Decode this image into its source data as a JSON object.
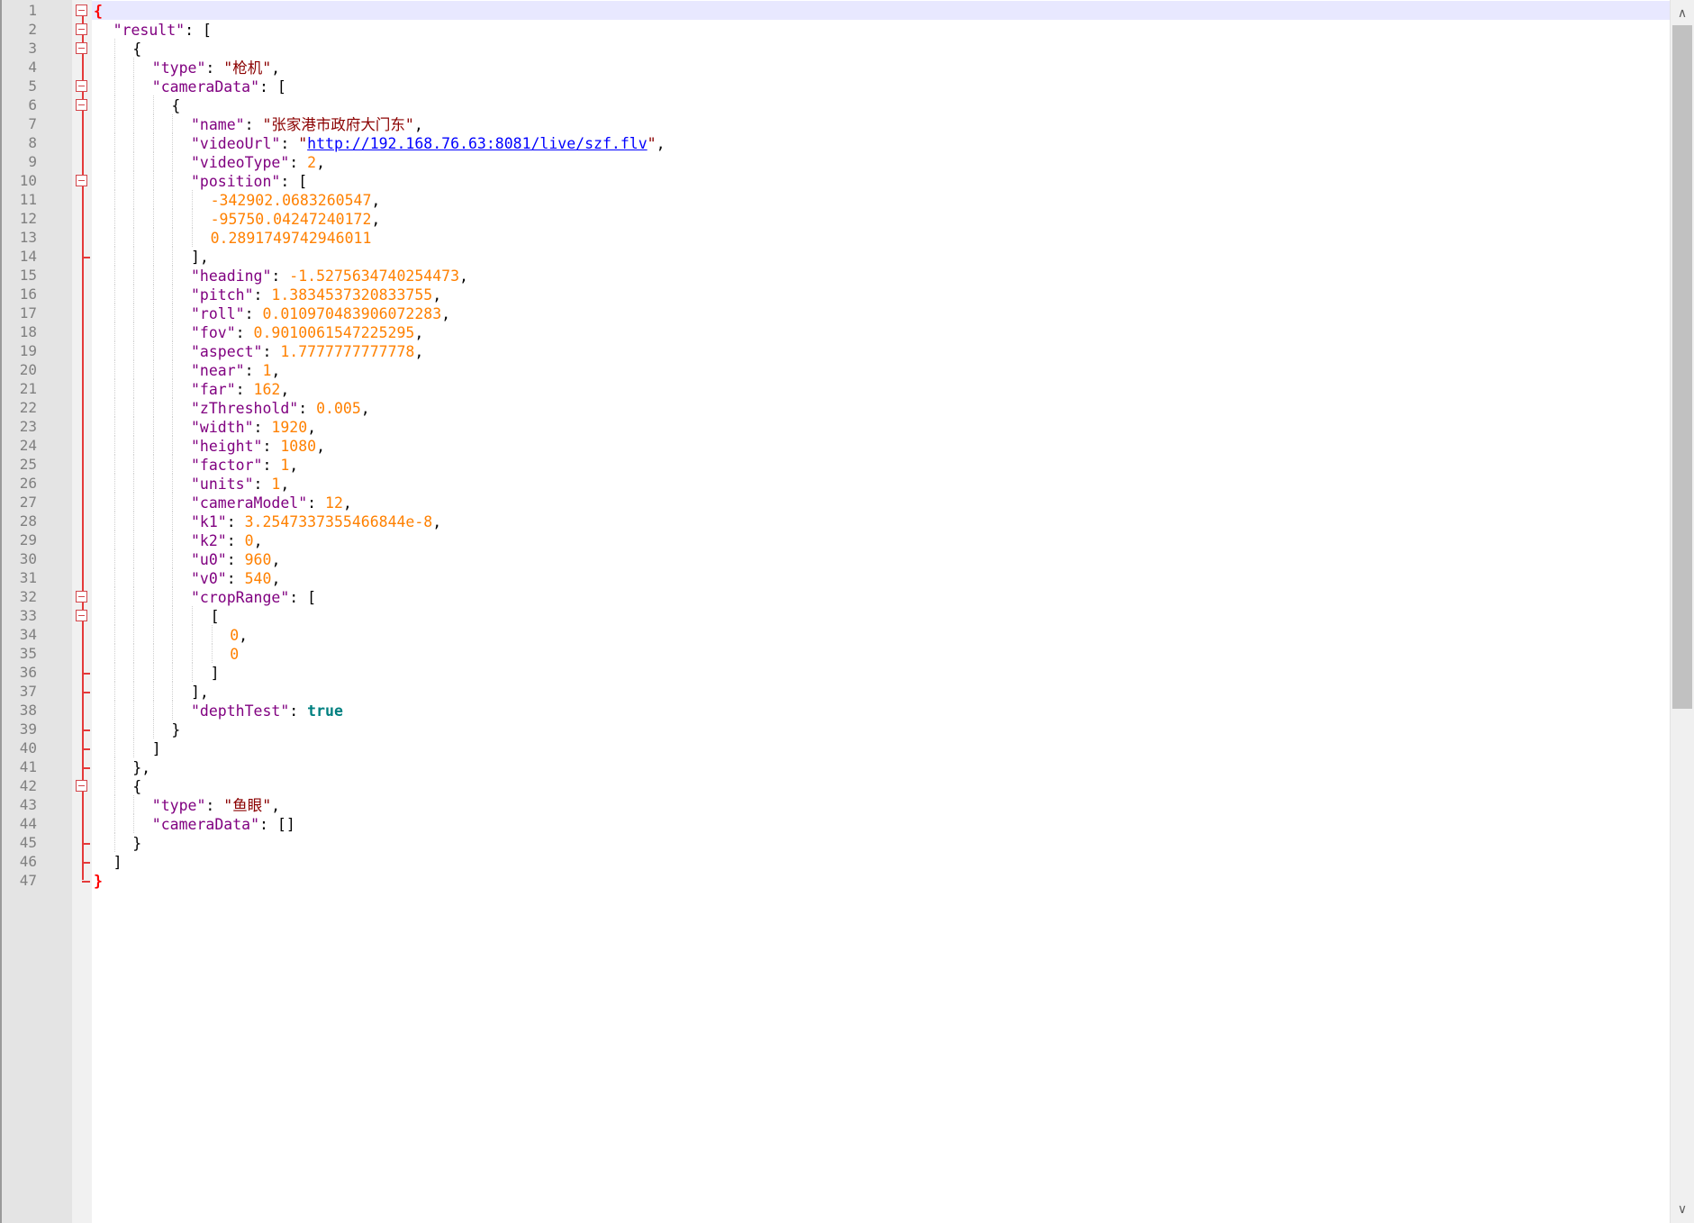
{
  "editor": {
    "line_numbers": [
      "1",
      "2",
      "3",
      "4",
      "5",
      "6",
      "7",
      "8",
      "9",
      "10",
      "11",
      "12",
      "13",
      "14",
      "15",
      "16",
      "17",
      "18",
      "19",
      "20",
      "21",
      "22",
      "23",
      "24",
      "25",
      "26",
      "27",
      "28",
      "29",
      "30",
      "31",
      "32",
      "33",
      "34",
      "35",
      "36",
      "37",
      "38",
      "39",
      "40",
      "41",
      "42",
      "43",
      "44",
      "45",
      "46",
      "47"
    ],
    "current_line": 1,
    "colors": {
      "key": "#800080",
      "string": "#8b0000",
      "number": "#ff8000",
      "bool": "#008080",
      "fold": "#e43a3a",
      "current_line_bg": "#e8e8ff"
    }
  },
  "code_lines": [
    [
      {
        "t": "br",
        "v": "{"
      }
    ],
    [
      {
        "t": "k",
        "v": "\"result\""
      },
      {
        "t": "p",
        "v": ": ["
      }
    ],
    [
      {
        "t": "p",
        "v": "{"
      }
    ],
    [
      {
        "t": "k",
        "v": "\"type\""
      },
      {
        "t": "p",
        "v": ": "
      },
      {
        "t": "s",
        "v": "\"枪机\""
      },
      {
        "t": "p",
        "v": ","
      }
    ],
    [
      {
        "t": "k",
        "v": "\"cameraData\""
      },
      {
        "t": "p",
        "v": ": ["
      }
    ],
    [
      {
        "t": "p",
        "v": "{"
      }
    ],
    [
      {
        "t": "k",
        "v": "\"name\""
      },
      {
        "t": "p",
        "v": ": "
      },
      {
        "t": "s",
        "v": "\"张家港市政府大门东\""
      },
      {
        "t": "p",
        "v": ","
      }
    ],
    [
      {
        "t": "k",
        "v": "\"videoUrl\""
      },
      {
        "t": "p",
        "v": ": "
      },
      {
        "t": "s",
        "v": "\""
      },
      {
        "t": "url",
        "v": "http://192.168.76.63:8081/live/szf.flv"
      },
      {
        "t": "s",
        "v": "\""
      },
      {
        "t": "p",
        "v": ","
      }
    ],
    [
      {
        "t": "k",
        "v": "\"videoType\""
      },
      {
        "t": "p",
        "v": ": "
      },
      {
        "t": "n",
        "v": "2"
      },
      {
        "t": "p",
        "v": ","
      }
    ],
    [
      {
        "t": "k",
        "v": "\"position\""
      },
      {
        "t": "p",
        "v": ": ["
      }
    ],
    [
      {
        "t": "n",
        "v": "-342902.0683260547"
      },
      {
        "t": "p",
        "v": ","
      }
    ],
    [
      {
        "t": "n",
        "v": "-95750.04247240172"
      },
      {
        "t": "p",
        "v": ","
      }
    ],
    [
      {
        "t": "n",
        "v": "0.2891749742946011"
      }
    ],
    [
      {
        "t": "p",
        "v": "],"
      }
    ],
    [
      {
        "t": "k",
        "v": "\"heading\""
      },
      {
        "t": "p",
        "v": ": "
      },
      {
        "t": "n",
        "v": "-1.5275634740254473"
      },
      {
        "t": "p",
        "v": ","
      }
    ],
    [
      {
        "t": "k",
        "v": "\"pitch\""
      },
      {
        "t": "p",
        "v": ": "
      },
      {
        "t": "n",
        "v": "1.3834537320833755"
      },
      {
        "t": "p",
        "v": ","
      }
    ],
    [
      {
        "t": "k",
        "v": "\"roll\""
      },
      {
        "t": "p",
        "v": ": "
      },
      {
        "t": "n",
        "v": "0.010970483906072283"
      },
      {
        "t": "p",
        "v": ","
      }
    ],
    [
      {
        "t": "k",
        "v": "\"fov\""
      },
      {
        "t": "p",
        "v": ": "
      },
      {
        "t": "n",
        "v": "0.9010061547225295"
      },
      {
        "t": "p",
        "v": ","
      }
    ],
    [
      {
        "t": "k",
        "v": "\"aspect\""
      },
      {
        "t": "p",
        "v": ": "
      },
      {
        "t": "n",
        "v": "1.7777777777778"
      },
      {
        "t": "p",
        "v": ","
      }
    ],
    [
      {
        "t": "k",
        "v": "\"near\""
      },
      {
        "t": "p",
        "v": ": "
      },
      {
        "t": "n",
        "v": "1"
      },
      {
        "t": "p",
        "v": ","
      }
    ],
    [
      {
        "t": "k",
        "v": "\"far\""
      },
      {
        "t": "p",
        "v": ": "
      },
      {
        "t": "n",
        "v": "162"
      },
      {
        "t": "p",
        "v": ","
      }
    ],
    [
      {
        "t": "k",
        "v": "\"zThreshold\""
      },
      {
        "t": "p",
        "v": ": "
      },
      {
        "t": "n",
        "v": "0.005"
      },
      {
        "t": "p",
        "v": ","
      }
    ],
    [
      {
        "t": "k",
        "v": "\"width\""
      },
      {
        "t": "p",
        "v": ": "
      },
      {
        "t": "n",
        "v": "1920"
      },
      {
        "t": "p",
        "v": ","
      }
    ],
    [
      {
        "t": "k",
        "v": "\"height\""
      },
      {
        "t": "p",
        "v": ": "
      },
      {
        "t": "n",
        "v": "1080"
      },
      {
        "t": "p",
        "v": ","
      }
    ],
    [
      {
        "t": "k",
        "v": "\"factor\""
      },
      {
        "t": "p",
        "v": ": "
      },
      {
        "t": "n",
        "v": "1"
      },
      {
        "t": "p",
        "v": ","
      }
    ],
    [
      {
        "t": "k",
        "v": "\"units\""
      },
      {
        "t": "p",
        "v": ": "
      },
      {
        "t": "n",
        "v": "1"
      },
      {
        "t": "p",
        "v": ","
      }
    ],
    [
      {
        "t": "k",
        "v": "\"cameraModel\""
      },
      {
        "t": "p",
        "v": ": "
      },
      {
        "t": "n",
        "v": "12"
      },
      {
        "t": "p",
        "v": ","
      }
    ],
    [
      {
        "t": "k",
        "v": "\"k1\""
      },
      {
        "t": "p",
        "v": ": "
      },
      {
        "t": "n",
        "v": "3.2547337355466844e-8"
      },
      {
        "t": "p",
        "v": ","
      }
    ],
    [
      {
        "t": "k",
        "v": "\"k2\""
      },
      {
        "t": "p",
        "v": ": "
      },
      {
        "t": "n",
        "v": "0"
      },
      {
        "t": "p",
        "v": ","
      }
    ],
    [
      {
        "t": "k",
        "v": "\"u0\""
      },
      {
        "t": "p",
        "v": ": "
      },
      {
        "t": "n",
        "v": "960"
      },
      {
        "t": "p",
        "v": ","
      }
    ],
    [
      {
        "t": "k",
        "v": "\"v0\""
      },
      {
        "t": "p",
        "v": ": "
      },
      {
        "t": "n",
        "v": "540"
      },
      {
        "t": "p",
        "v": ","
      }
    ],
    [
      {
        "t": "k",
        "v": "\"cropRange\""
      },
      {
        "t": "p",
        "v": ": ["
      }
    ],
    [
      {
        "t": "p",
        "v": "["
      }
    ],
    [
      {
        "t": "n",
        "v": "0"
      },
      {
        "t": "p",
        "v": ","
      }
    ],
    [
      {
        "t": "n",
        "v": "0"
      }
    ],
    [
      {
        "t": "p",
        "v": "]"
      }
    ],
    [
      {
        "t": "p",
        "v": "],"
      }
    ],
    [
      {
        "t": "k",
        "v": "\"depthTest\""
      },
      {
        "t": "p",
        "v": ": "
      },
      {
        "t": "b",
        "v": "true"
      }
    ],
    [
      {
        "t": "p",
        "v": "}"
      }
    ],
    [
      {
        "t": "p",
        "v": "]"
      }
    ],
    [
      {
        "t": "p",
        "v": "},"
      }
    ],
    [
      {
        "t": "p",
        "v": "{"
      }
    ],
    [
      {
        "t": "k",
        "v": "\"type\""
      },
      {
        "t": "p",
        "v": ": "
      },
      {
        "t": "s",
        "v": "\"鱼眼\""
      },
      {
        "t": "p",
        "v": ","
      }
    ],
    [
      {
        "t": "k",
        "v": "\"cameraData\""
      },
      {
        "t": "p",
        "v": ": []"
      }
    ],
    [
      {
        "t": "p",
        "v": "}"
      }
    ],
    [
      {
        "t": "p",
        "v": "]"
      }
    ],
    [
      {
        "t": "br",
        "v": "}"
      }
    ]
  ],
  "scrollbar": {
    "up_icon": "chevron-up-icon",
    "down_icon": "chevron-down-icon",
    "up_glyph": "∧",
    "down_glyph": "∨"
  }
}
